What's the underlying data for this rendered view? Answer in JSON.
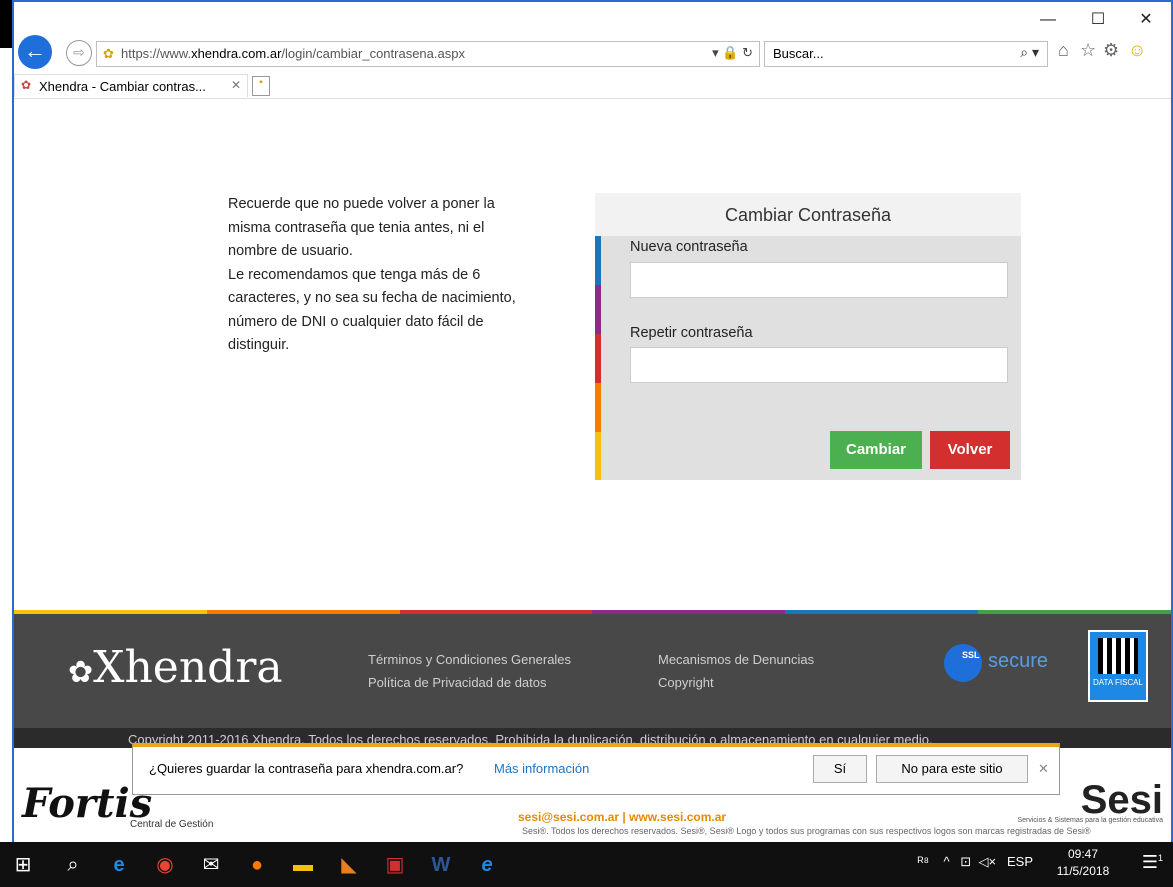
{
  "browser": {
    "url_host_prefix": "https://www.",
    "url_host": "xhendra.com.ar",
    "url_path": "/login/cambiar_contrasena.aspx",
    "search_placeholder": "Buscar...",
    "tab_title": "Xhendra - Cambiar contras...",
    "controls": {
      "minimize": "—",
      "maximize": "☐",
      "close": "✕"
    }
  },
  "page": {
    "info_lines": [
      "Recuerde que no puede volver a poner la",
      "misma contraseña que tenia antes, ni el",
      "nombre de usuario.",
      "Le recomendamos que tenga más de 6",
      "caracteres, y no sea su fecha de nacimiento,",
      "número de DNI o cualquier dato fácil de",
      "distinguir."
    ],
    "form": {
      "title": "Cambiar Contraseña",
      "new_password_label": "Nueva contraseña",
      "repeat_password_label": "Repetir contraseña",
      "new_password_value": "",
      "repeat_password_value": "",
      "submit_label": "Cambiar",
      "back_label": "Volver",
      "stripe_colors": [
        "#1b75bb",
        "#8e2a8e",
        "#d32f2f",
        "#f57c00",
        "#f4c20d"
      ]
    }
  },
  "footer": {
    "logo": "Xhendra",
    "links_col1": [
      "Términos y Condiciones Generales",
      "Política de Privacidad de datos"
    ],
    "links_col2": [
      "Mecanismos de Denuncias",
      "Copyright"
    ],
    "ssl_badge": "SSL",
    "secure_text": "secure",
    "data_fiscal": "DATA FISCAL",
    "copyright": "Copyright 2011-2016 Xhendra. Todos los derechos reservados. Prohibida la duplicación, distribución o almacenamiento en cualquier medio.",
    "rainbow_colors": [
      "#f4c20d",
      "#f57c00",
      "#d32f2f",
      "#8e2a8e",
      "#1b75bb",
      "#43a047"
    ]
  },
  "partner_strip": {
    "brand_left": "Fortis",
    "brand_left_sub": "Central de Gestión",
    "contact": "sesi@sesi.com.ar | www.sesi.com.ar",
    "legal": "Sesi®. Todos los derechos reservados. Sesi®, Sesi® Logo y todos sus programas con sus respectivos logos son marcas registradas de Sesi®",
    "brand_right": "Sesi",
    "brand_right_tag": "Servicios & Sistemas para la gestión educativa"
  },
  "password_prompt": {
    "question": "¿Quieres guardar la contraseña para xhendra.com.ar?",
    "more_info": "Más información",
    "yes_label": "Sí",
    "never_label": "No para este sitio",
    "close": "✕"
  },
  "taskbar": {
    "language": "ESP",
    "time": "09:47",
    "date": "11/5/2018",
    "notifications": "1"
  }
}
